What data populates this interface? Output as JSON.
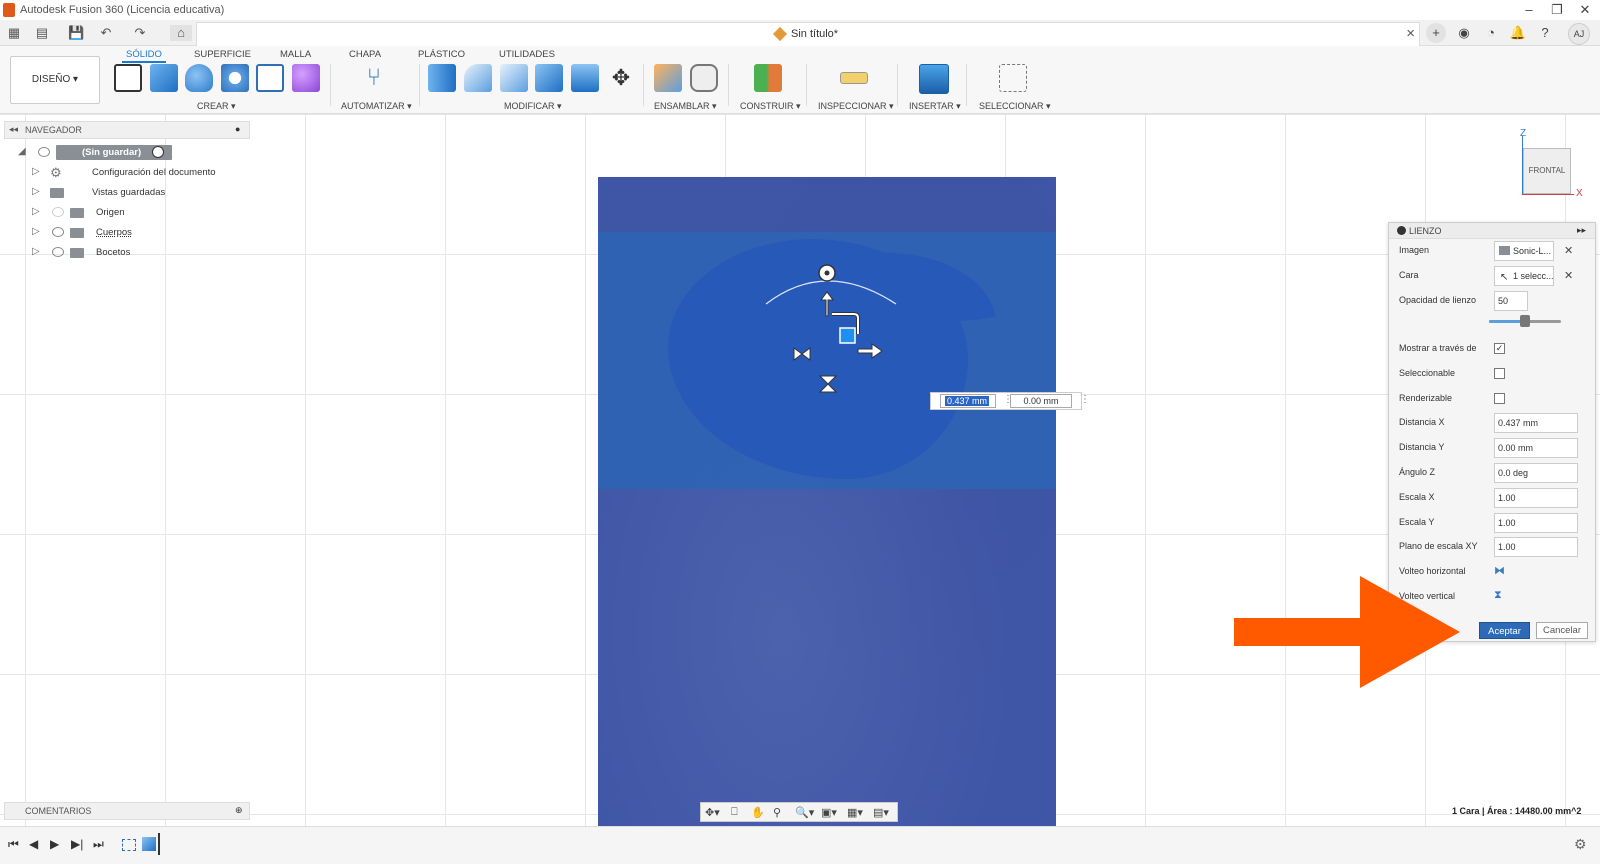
{
  "window": {
    "title": "Autodesk Fusion 360 (Licencia educativa)"
  },
  "document": {
    "tab_title": "Sin título*"
  },
  "user": {
    "initials": "AJ"
  },
  "ribbon": {
    "workspace_button": "DISEÑO ▾",
    "tabs": [
      "SÓLIDO",
      "SUPERFICIE",
      "MALLA",
      "CHAPA",
      "PLÁSTICO",
      "UTILIDADES"
    ],
    "groups": [
      "CREAR ▾",
      "AUTOMATIZAR ▾",
      "MODIFICAR ▾",
      "ENSAMBLAR ▾",
      "CONSTRUIR ▾",
      "INSPECCIONAR ▾",
      "INSERTAR ▾",
      "SELECCIONAR ▾"
    ]
  },
  "navigator": {
    "title": "NAVEGADOR",
    "root": "(Sin guardar)",
    "items": [
      "Configuración del documento",
      "Vistas guardadas",
      "Origen",
      "Cuerpos",
      "Bocetos"
    ]
  },
  "comments": {
    "title": "COMENTARIOS"
  },
  "viewcube": {
    "face": "FRONTAL",
    "z_axis": "Z",
    "x_axis": "X"
  },
  "gizmo": {
    "distance_x": "0.437 mm",
    "distance_y": "0.00 mm"
  },
  "canvas_panel": {
    "title": "LIENZO",
    "fields": {
      "imagen_label": "Imagen",
      "imagen_value": "Sonic-L...",
      "cara_label": "Cara",
      "cara_value": "1 selecc...",
      "opacidad_label": "Opacidad de lienzo",
      "opacidad_value": "50",
      "mostrar_label": "Mostrar a través de",
      "seleccionable_label": "Seleccionable",
      "renderizable_label": "Renderizable",
      "distx_label": "Distancia X",
      "distx_value": "0.437 mm",
      "disty_label": "Distancia Y",
      "disty_value": "0.00 mm",
      "angz_label": "Ángulo Z",
      "angz_value": "0.0 deg",
      "escx_label": "Escala X",
      "escx_value": "1.00",
      "escy_label": "Escala Y",
      "escy_value": "1.00",
      "planoxy_label": "Plano de escala XY",
      "planoxy_value": "1.00",
      "volteoh_label": "Volteo horizontal",
      "volteov_label": "Volteo vertical"
    },
    "opacity_slider": 50,
    "checks": {
      "mostrar": true,
      "seleccionable": false,
      "renderizable": false
    },
    "accept": "Aceptar",
    "cancel": "Cancelar"
  },
  "status": {
    "selection": "1 Cara | Área : 14480.00 mm^2"
  },
  "colors": {
    "accent": "#1a79d1",
    "arrow": "#ff5a00",
    "canvas": "#3f56a6",
    "accept": "#2d6bb8"
  }
}
